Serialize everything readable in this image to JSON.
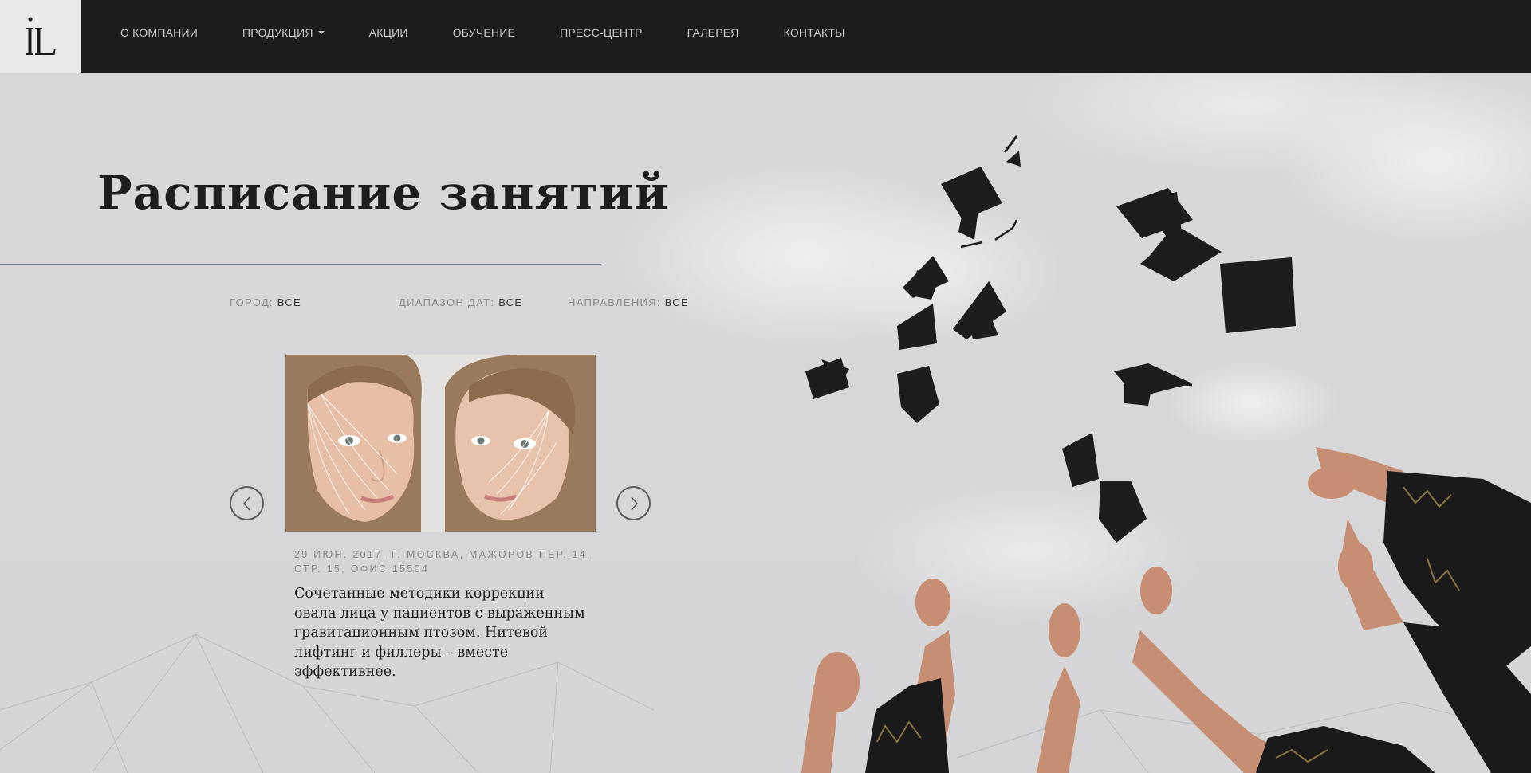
{
  "nav": {
    "logo_alt": "IL",
    "items": [
      {
        "label": "О КОМПАНИИ"
      },
      {
        "label": "ПРОДУКЦИЯ"
      },
      {
        "label": "АКЦИИ"
      },
      {
        "label": "ОБУЧЕНИЕ"
      },
      {
        "label": "ПРЕСС-ЦЕНТР"
      },
      {
        "label": "ГАЛЕРЕЯ"
      },
      {
        "label": "КОНТАКТЫ"
      }
    ]
  },
  "page": {
    "title": "Расписание занятий"
  },
  "filters": {
    "city": {
      "label": "ГОРОД:",
      "value": "ВСЕ"
    },
    "dates": {
      "label": "ДИАПАЗОН ДАТ:",
      "value": "ВСЕ"
    },
    "directions": {
      "label": "НАПРАВЛЕНИЯ:",
      "value": "ВСЕ"
    }
  },
  "event": {
    "meta": "29 ИЮН. 2017, Г. МОСКВА, МАЖОРОВ ПЕР. 14, СТР. 15, ОФИС 15504",
    "title": "Сочетанные методики коррекции овала лица у пациентов с выраженным гравитационным птозом. Нитевой лифтинг и филлеры – вместе эффективнее."
  },
  "colors": {
    "nav_bg": "#1c1c1c",
    "hero_bg": "#d6d6d8",
    "rule": "#6f8191",
    "text_dark": "#1e1e1e"
  }
}
